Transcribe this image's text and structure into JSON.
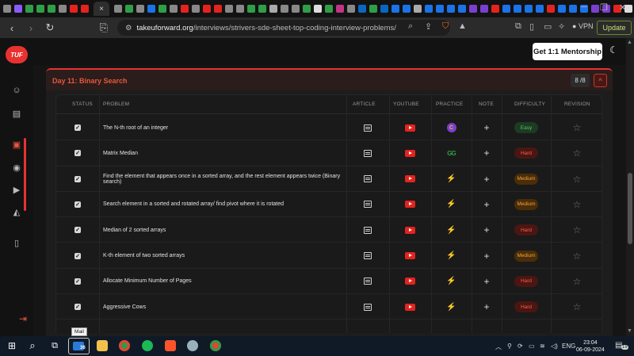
{
  "browser": {
    "url_domain": "takeuforward.org",
    "url_path": "/interviews/strivers-sde-sheet-top-coding-interview-problems/",
    "vpn_label": "VPN",
    "update_label": "Update",
    "tab_icon_colors": [
      "#888",
      "#8a5cf6",
      "#2f9e47",
      "#2f9e47",
      "#2f9e47",
      "#888",
      "#e4231e",
      "#e4231e",
      "#888",
      "#2f9e47",
      "#888",
      "#1a73e8",
      "#2f9e47",
      "#888",
      "#e4231e",
      "#888",
      "#e4231e",
      "#e4231e",
      "#888",
      "#888",
      "#2f9e47",
      "#2f9e47",
      "#aaa",
      "#888",
      "#888",
      "#2f9e47",
      "#ddd",
      "#2f9e47",
      "#c13584",
      "#888",
      "#0a66c2",
      "#2f9e47",
      "#0a66c2",
      "#1a73e8",
      "#1a73e8",
      "#aaa",
      "#1a73e8",
      "#1a73e8",
      "#1a73e8",
      "#1a73e8",
      "#7b3fcf",
      "#7b3fcf",
      "#e4231e",
      "#1a73e8",
      "#1a73e8",
      "#1a73e8",
      "#1a73e8",
      "#e4231e",
      "#1a73e8",
      "#1a73e8",
      "#1a73e8",
      "#7b3fcf",
      "#7b3fcf",
      "#e4231e",
      "#ddd"
    ],
    "active_tab_close": "×"
  },
  "header": {
    "logo_text": "TUF",
    "mentorship_label": "Get 1:1 Mentorship"
  },
  "section": {
    "title": "Day 11: Binary Search",
    "progress": "8 /8",
    "collapse_icon": "^"
  },
  "table": {
    "headers": {
      "status": "STATUS",
      "problem": "PROBLEM",
      "article": "ARTICLE",
      "youtube": "YOUTUBE",
      "practice": "PRACTICE",
      "note": "NOTE",
      "difficulty": "DIFFICULTY",
      "revision": "REVISION"
    },
    "rows": [
      {
        "problem": "The N-th root of an integer",
        "practice": "codingninjas",
        "difficulty": "Easy",
        "checked": true
      },
      {
        "problem": "Matrix Median",
        "practice": "geeksforgeeks",
        "difficulty": "Hard",
        "checked": true
      },
      {
        "problem": "Find the element that appears once in a sorted array, and the rest element appears twice (Binary search)",
        "practice": "codestudio",
        "difficulty": "Medium",
        "checked": true
      },
      {
        "problem": "Search element in a sorted and rotated array/ find pivot where it is rotated",
        "practice": "codestudio",
        "difficulty": "Medium",
        "checked": true
      },
      {
        "problem": "Median of 2 sorted arrays",
        "practice": "codestudio",
        "difficulty": "Hard",
        "checked": true
      },
      {
        "problem": "K-th element of two sorted arrays",
        "practice": "codestudio",
        "difficulty": "Medium",
        "checked": true
      },
      {
        "problem": "Allocate Minimum Number of Pages",
        "practice": "codestudio",
        "difficulty": "Hard",
        "checked": true
      },
      {
        "problem": "Aggressive Cows",
        "practice": "codestudio",
        "difficulty": "Hard",
        "checked": true
      }
    ],
    "difficulty_colors": {
      "Easy": "#57c26b",
      "Medium": "#f2a23a",
      "Hard": "#ff5a47"
    }
  },
  "taskbar": {
    "mail_tooltip": "Mail",
    "mail_badge": "36",
    "language": "ENG",
    "time": "23:04",
    "date": "06-09-2024",
    "notification_count": "19"
  }
}
